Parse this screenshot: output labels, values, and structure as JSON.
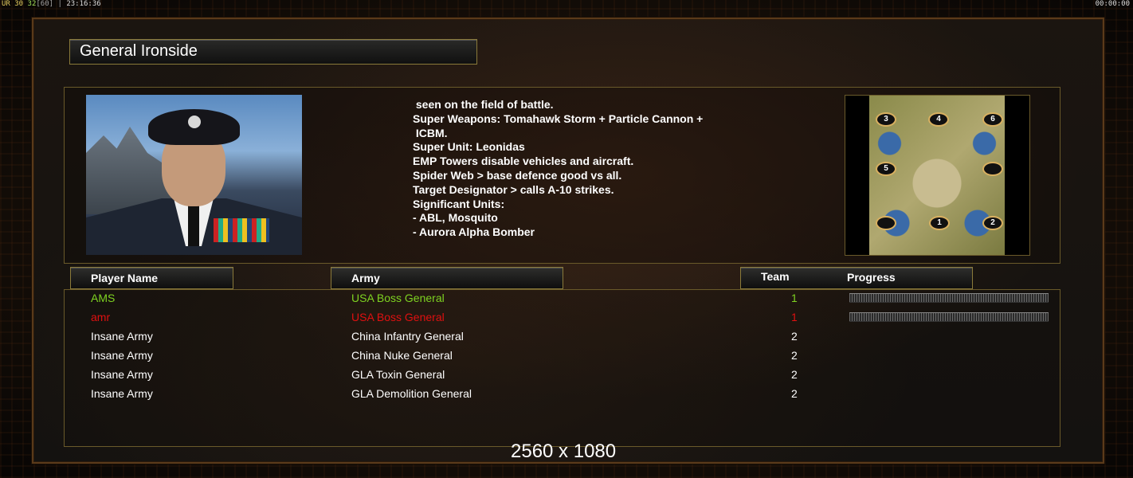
{
  "hud": {
    "fps_label": "UR",
    "fps_a": "30",
    "fps_b": "32",
    "fps_c": "[60]",
    "clock": "23:16:36",
    "timer": "00:00:00"
  },
  "general": {
    "title": "General Ironside"
  },
  "description": {
    "lines": [
      " seen on the field of battle.",
      "",
      "Super Weapons: Tomahawk Storm + Particle Cannon +",
      " ICBM.",
      "Super Unit: Leonidas",
      "EMP Towers disable vehicles and aircraft.",
      "Spider Web > base defence good vs all.",
      "Target Designator > calls A-10 strikes.",
      "Significant Units:",
      "- ABL, Mosquito",
      "- Aurora Alpha Bomber"
    ]
  },
  "map": {
    "spawns": [
      "3",
      "4",
      "6",
      "5",
      "",
      "",
      "1",
      "2"
    ]
  },
  "table": {
    "headers": {
      "player_name": "Player Name",
      "army": "Army",
      "team": "Team",
      "progress": "Progress"
    },
    "rows": [
      {
        "name": "AMS",
        "army": "USA Boss General",
        "team": "1",
        "color": "#7ed321",
        "progress": 1.0
      },
      {
        "name": "amr",
        "army": "USA Boss General",
        "team": "1",
        "color": "#e01010",
        "progress": 1.0
      },
      {
        "name": "Insane Army",
        "army": "China Infantry General",
        "team": "2",
        "color": "#ffffff",
        "progress": null
      },
      {
        "name": "Insane Army",
        "army": "China Nuke General",
        "team": "2",
        "color": "#ffffff",
        "progress": null
      },
      {
        "name": "Insane Army",
        "army": "GLA Toxin General",
        "team": "2",
        "color": "#ffffff",
        "progress": null
      },
      {
        "name": "Insane Army",
        "army": "GLA Demolition General",
        "team": "2",
        "color": "#ffffff",
        "progress": null
      }
    ]
  },
  "resolution": "2560 x 1080"
}
